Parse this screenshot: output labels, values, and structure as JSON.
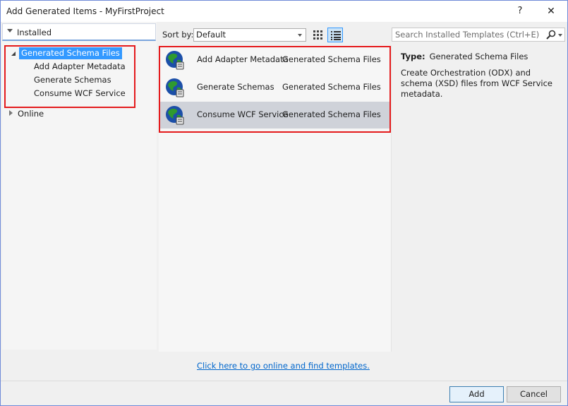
{
  "window": {
    "title": "Add Generated Items - MyFirstProject",
    "help_label": "?",
    "close_label": "✕"
  },
  "tree": {
    "installed_label": "Installed",
    "selected_node": "Generated Schema Files",
    "children": [
      "Add Adapter Metadata",
      "Generate Schemas",
      "Consume WCF Service"
    ],
    "online_label": "Online"
  },
  "toolbar": {
    "sort_label": "Sort by:",
    "sort_value": "Default",
    "search_placeholder": "Search Installed Templates (Ctrl+E)"
  },
  "templates": [
    {
      "name": "Add Adapter Metadata",
      "category": "Generated Schema Files",
      "icon": "globe-icon",
      "selected": false
    },
    {
      "name": "Generate Schemas",
      "category": "Generated Schema Files",
      "icon": "globe-icon",
      "selected": false
    },
    {
      "name": "Consume WCF Service",
      "category": "Generated Schema Files",
      "icon": "globe-icon",
      "selected": true
    }
  ],
  "details": {
    "type_label": "Type:",
    "type_value": "Generated Schema Files",
    "description": "Create Orchestration (ODX) and schema (XSD) files from WCF Service metadata."
  },
  "online_link": "Click here to go online and find templates.",
  "buttons": {
    "add": "Add",
    "cancel": "Cancel"
  },
  "colors": {
    "selection": "#3399ff",
    "highlight_box": "#e41a1c",
    "link": "#0066cc"
  }
}
